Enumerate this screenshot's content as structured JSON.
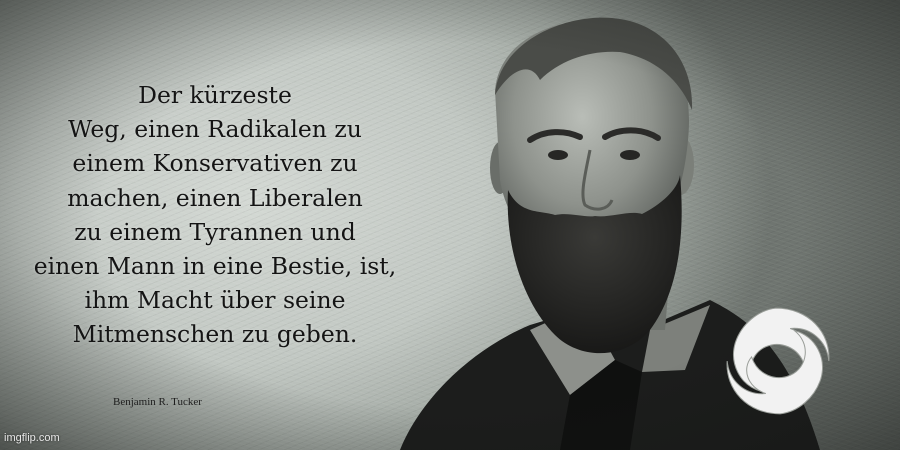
{
  "quote": {
    "lines": [
      "Der kürzeste",
      "Weg, einen Radikalen zu",
      "einem Konservativen zu",
      "machen, einen Liberalen",
      "zu einem Tyrannen und",
      "einen Mann in eine Bestie, ist,",
      "ihm Macht über seine",
      "Mitmenschen zu geben."
    ]
  },
  "author": "Benjamin R. Tucker",
  "watermark": "imgflip.com",
  "logo": {
    "icon": "swirl-emblem-icon",
    "color": "#f2f2f2"
  },
  "colors": {
    "background": "#c8cdc8",
    "text": "#141414",
    "photo_dark": "#1c1d1c"
  }
}
